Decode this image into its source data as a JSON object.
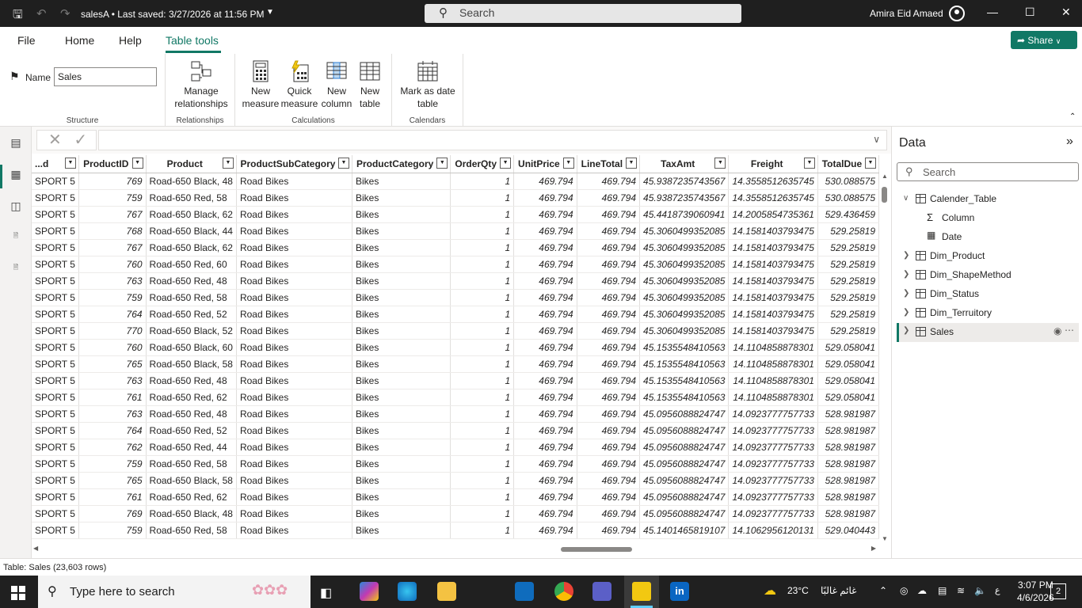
{
  "titlebar": {
    "document": "salesA",
    "saved": "Last saved: 3/27/2026 at 11:56 PM",
    "search_placeholder": "Search",
    "user": "Amira Eid Amaed"
  },
  "menu": {
    "file": "File",
    "home": "Home",
    "help": "Help",
    "table_tools": "Table tools",
    "share": "Share"
  },
  "ribbon": {
    "name_label": "Name",
    "name_value": "Sales",
    "structure": "Structure",
    "manage_relationships": [
      "Manage",
      "relationships"
    ],
    "relationships": "Relationships",
    "new_measure": [
      "New",
      "measure"
    ],
    "quick_measure": [
      "Quick",
      "measure"
    ],
    "new_column": [
      "New",
      "column"
    ],
    "new_table": [
      "New",
      "table"
    ],
    "calculations": "Calculations",
    "mark_as_date_table": [
      "Mark as date",
      "table"
    ],
    "calendars": "Calendars"
  },
  "table": {
    "columns": [
      "...d",
      "ProductID",
      "Product",
      "ProductSubCategory",
      "ProductCategory",
      "OrderQty",
      "UnitPrice",
      "LineTotal",
      "TaxAmt",
      "Freight",
      "TotalDue"
    ],
    "rows": [
      [
        "SPORT 5",
        "769",
        "Road-650 Black, 48",
        "Road Bikes",
        "Bikes",
        "1",
        "469.794",
        "469.794",
        "45.9387235743567",
        "14.3558512635745",
        "530.088575"
      ],
      [
        "SPORT 5",
        "759",
        "Road-650 Red, 58",
        "Road Bikes",
        "Bikes",
        "1",
        "469.794",
        "469.794",
        "45.9387235743567",
        "14.3558512635745",
        "530.088575"
      ],
      [
        "SPORT 5",
        "767",
        "Road-650 Black, 62",
        "Road Bikes",
        "Bikes",
        "1",
        "469.794",
        "469.794",
        "45.4418739060941",
        "14.2005854735361",
        "529.436459"
      ],
      [
        "SPORT 5",
        "768",
        "Road-650 Black, 44",
        "Road Bikes",
        "Bikes",
        "1",
        "469.794",
        "469.794",
        "45.3060499352085",
        "14.1581403793475",
        "529.25819"
      ],
      [
        "SPORT 5",
        "767",
        "Road-650 Black, 62",
        "Road Bikes",
        "Bikes",
        "1",
        "469.794",
        "469.794",
        "45.3060499352085",
        "14.1581403793475",
        "529.25819"
      ],
      [
        "SPORT 5",
        "760",
        "Road-650 Red, 60",
        "Road Bikes",
        "Bikes",
        "1",
        "469.794",
        "469.794",
        "45.3060499352085",
        "14.1581403793475",
        "529.25819"
      ],
      [
        "SPORT 5",
        "763",
        "Road-650 Red, 48",
        "Road Bikes",
        "Bikes",
        "1",
        "469.794",
        "469.794",
        "45.3060499352085",
        "14.1581403793475",
        "529.25819"
      ],
      [
        "SPORT 5",
        "759",
        "Road-650 Red, 58",
        "Road Bikes",
        "Bikes",
        "1",
        "469.794",
        "469.794",
        "45.3060499352085",
        "14.1581403793475",
        "529.25819"
      ],
      [
        "SPORT 5",
        "764",
        "Road-650 Red, 52",
        "Road Bikes",
        "Bikes",
        "1",
        "469.794",
        "469.794",
        "45.3060499352085",
        "14.1581403793475",
        "529.25819"
      ],
      [
        "SPORT 5",
        "770",
        "Road-650 Black, 52",
        "Road Bikes",
        "Bikes",
        "1",
        "469.794",
        "469.794",
        "45.3060499352085",
        "14.1581403793475",
        "529.25819"
      ],
      [
        "SPORT 5",
        "760",
        "Road-650 Black, 60",
        "Road Bikes",
        "Bikes",
        "1",
        "469.794",
        "469.794",
        "45.1535548410563",
        "14.1104858878301",
        "529.058041"
      ],
      [
        "SPORT 5",
        "765",
        "Road-650 Black, 58",
        "Road Bikes",
        "Bikes",
        "1",
        "469.794",
        "469.794",
        "45.1535548410563",
        "14.1104858878301",
        "529.058041"
      ],
      [
        "SPORT 5",
        "763",
        "Road-650 Red, 48",
        "Road Bikes",
        "Bikes",
        "1",
        "469.794",
        "469.794",
        "45.1535548410563",
        "14.1104858878301",
        "529.058041"
      ],
      [
        "SPORT 5",
        "761",
        "Road-650 Red, 62",
        "Road Bikes",
        "Bikes",
        "1",
        "469.794",
        "469.794",
        "45.1535548410563",
        "14.1104858878301",
        "529.058041"
      ],
      [
        "SPORT 5",
        "763",
        "Road-650 Red, 48",
        "Road Bikes",
        "Bikes",
        "1",
        "469.794",
        "469.794",
        "45.0956088824747",
        "14.0923777757733",
        "528.981987"
      ],
      [
        "SPORT 5",
        "764",
        "Road-650 Red, 52",
        "Road Bikes",
        "Bikes",
        "1",
        "469.794",
        "469.794",
        "45.0956088824747",
        "14.0923777757733",
        "528.981987"
      ],
      [
        "SPORT 5",
        "762",
        "Road-650 Red, 44",
        "Road Bikes",
        "Bikes",
        "1",
        "469.794",
        "469.794",
        "45.0956088824747",
        "14.0923777757733",
        "528.981987"
      ],
      [
        "SPORT 5",
        "759",
        "Road-650 Red, 58",
        "Road Bikes",
        "Bikes",
        "1",
        "469.794",
        "469.794",
        "45.0956088824747",
        "14.0923777757733",
        "528.981987"
      ],
      [
        "SPORT 5",
        "765",
        "Road-650 Black, 58",
        "Road Bikes",
        "Bikes",
        "1",
        "469.794",
        "469.794",
        "45.0956088824747",
        "14.0923777757733",
        "528.981987"
      ],
      [
        "SPORT 5",
        "761",
        "Road-650 Red, 62",
        "Road Bikes",
        "Bikes",
        "1",
        "469.794",
        "469.794",
        "45.0956088824747",
        "14.0923777757733",
        "528.981987"
      ],
      [
        "SPORT 5",
        "769",
        "Road-650 Black, 48",
        "Road Bikes",
        "Bikes",
        "1",
        "469.794",
        "469.794",
        "45.0956088824747",
        "14.0923777757733",
        "528.981987"
      ],
      [
        "SPORT 5",
        "759",
        "Road-650 Red, 58",
        "Road Bikes",
        "Bikes",
        "1",
        "469.794",
        "469.794",
        "45.1401465819107",
        "14.1062956120131",
        "529.040443"
      ]
    ]
  },
  "data_pane": {
    "title": "Data",
    "search_placeholder": "Search",
    "calender_table": "Calender_Table",
    "column": "Column",
    "date": "Date",
    "dim_product": "Dim_Product",
    "dim_shapemethod": "Dim_ShapeMethod",
    "dim_status": "Dim_Status",
    "dim_terruitory": "Dim_Terruitory",
    "sales": "Sales"
  },
  "status": "Table: Sales (23,603 rows)",
  "taskbar": {
    "search_placeholder": "Type here to search",
    "temperature": "23°C",
    "weather": "غائم غالبًا",
    "time": "3:07 PM",
    "date": "4/6/2026",
    "notifications": "2"
  },
  "colors": {
    "accent": "#117865",
    "titlebar": "#1f1f1f",
    "taskbar": "#202020"
  }
}
